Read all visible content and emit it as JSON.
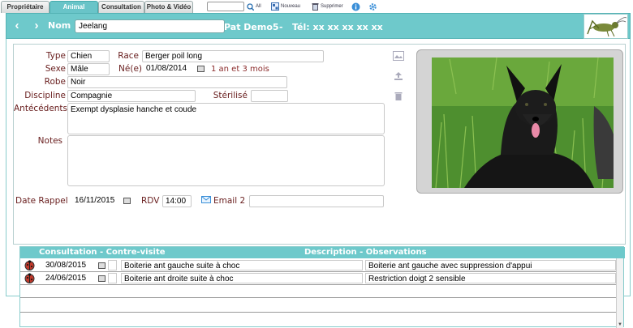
{
  "tabs": [
    {
      "label": "Propriétaire",
      "active": false
    },
    {
      "label": "Animal",
      "active": true
    },
    {
      "label": "Consultation",
      "active": false
    },
    {
      "label": "Photo & Vidéo",
      "active": false
    }
  ],
  "toolbar": {
    "all_label": "All",
    "new_label": "Nouveau",
    "delete_label": "Supprimer"
  },
  "header": {
    "nom_label": "Nom",
    "name_value": "Jeelang",
    "pat_label": "Pat Demo5",
    "separator": "-",
    "tel_label": "Tél: xx xx xx xx xx"
  },
  "form": {
    "type_label": "Type",
    "type_value": "Chien",
    "race_label": "Race",
    "race_value": "Berger poil long",
    "sexe_label": "Sexe",
    "sexe_value": "Mâle",
    "ne_label": "Né(e)",
    "ne_value": "01/08/2014",
    "age_text": "1 an et 3 mois",
    "robe_label": "Robe",
    "robe_value": "Noir",
    "discipline_label": "Discipline",
    "discipline_value": "Compagnie",
    "sterilise_label": "Stérilisé",
    "sterilise_value": "",
    "antecedents_label": "Antécédents",
    "antecedents_value": "Exempt dysplasie hanche et coude",
    "notes_label": "Notes",
    "notes_value": "",
    "rappel_label": "Date Rappel",
    "rappel_value": "16/11/2015",
    "rdv_label": "RDV",
    "rdv_value": "14:00",
    "email_label": "Email 2",
    "email_value": ""
  },
  "grid": {
    "head_consult": "Consultation - Contre-visite",
    "head_desc": "Description - Observations",
    "rows": [
      {
        "date": "30/08/2015",
        "desc": "Boiterie ant gauche suite à choc",
        "obs": "Boiterie ant gauche avec suppression d'appui"
      },
      {
        "date": "24/06/2015",
        "desc": "Boiterie ant droite suite à choc",
        "obs": "Restriction doigt 2 sensible"
      }
    ]
  },
  "colors": {
    "accent": "#6ec9cb",
    "label": "#6a2020"
  }
}
